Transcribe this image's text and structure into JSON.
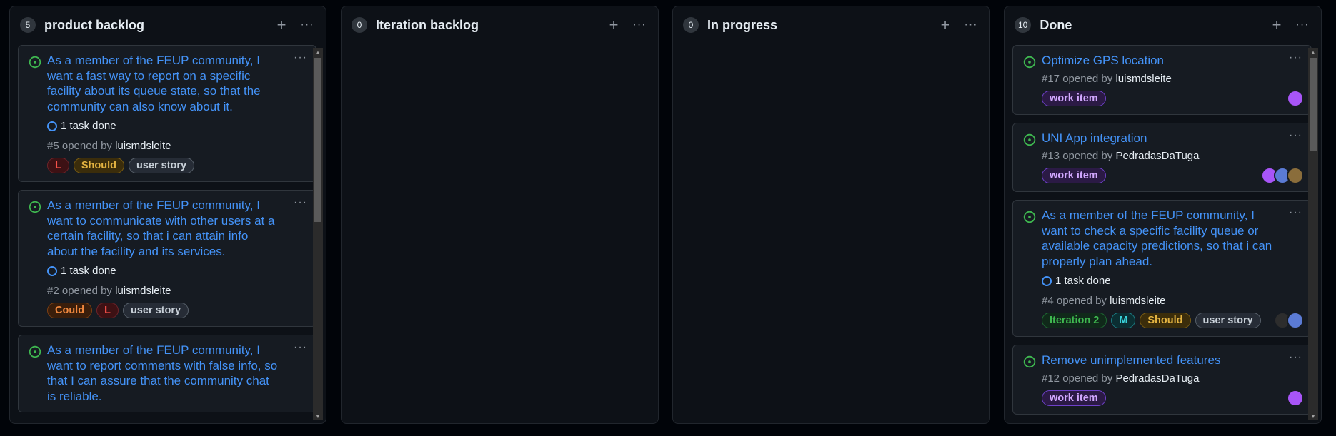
{
  "colors": {
    "page_bg": "#010409",
    "column_bg": "#0d1117",
    "card_bg": "#161b22",
    "link": "#4493f8",
    "open_green": "#3fb950",
    "muted": "#9198a1"
  },
  "icons": {
    "add": "+",
    "more": "···",
    "open_issue": "open-issue-icon",
    "task": "task-ring-icon",
    "scroll_up": "▲",
    "scroll_down": "▼"
  },
  "columns": [
    {
      "name": "product backlog",
      "count": "5",
      "scroll_position": 0.0,
      "cards": [
        {
          "title": "As a member of the FEUP community, I want a fast way to report on a specific facility about its queue state, so that the community can also know about it.",
          "tasks": "1 task done",
          "number": "#5",
          "opened_by": "opened by",
          "author": "luismdsleite",
          "labels": [
            {
              "text": "L",
              "color": "#f85149",
              "bg": "#3d1114",
              "border": "#6e2329"
            },
            {
              "text": "Should",
              "color": "#e3b341",
              "bg": "#3b2d0b",
              "border": "#7a5c12"
            },
            {
              "text": "user story",
              "color": "#c9d1d9",
              "bg": "#262c36",
              "border": "#57606a"
            }
          ]
        },
        {
          "title": "As a member of the FEUP community, I want to communicate with other users at a certain facility, so that i can attain info about the facility and its services.",
          "tasks": "1 task done",
          "number": "#2",
          "opened_by": "opened by",
          "author": "luismdsleite",
          "labels": [
            {
              "text": "Could",
              "color": "#f0883e",
              "bg": "#3a1e0b",
              "border": "#7d3f12"
            },
            {
              "text": "L",
              "color": "#f85149",
              "bg": "#3d1114",
              "border": "#6e2329"
            },
            {
              "text": "user story",
              "color": "#c9d1d9",
              "bg": "#262c36",
              "border": "#57606a"
            }
          ]
        },
        {
          "title": "As a member of the FEUP community, I want to report comments with false info, so that I can assure that the community chat is reliable."
        }
      ]
    },
    {
      "name": "Iteration backlog",
      "count": "0",
      "cards": []
    },
    {
      "name": "In progress",
      "count": "0",
      "cards": []
    },
    {
      "name": "Done",
      "count": "10",
      "scroll_position": 0.0,
      "cards": [
        {
          "title": "Optimize GPS location",
          "number": "#17",
          "opened_by": "opened by",
          "author": "luismdsleite",
          "labels": [
            {
              "text": "work item",
              "color": "#d2a8ff",
              "bg": "#2b1a45",
              "border": "#6e40c9"
            }
          ],
          "avatars": [
            "#a855f7"
          ]
        },
        {
          "title": "UNI App integration",
          "number": "#13",
          "opened_by": "opened by",
          "author": "PedradasDaTuga",
          "labels": [
            {
              "text": "work item",
              "color": "#d2a8ff",
              "bg": "#2b1a45",
              "border": "#6e40c9"
            }
          ],
          "avatars": [
            "#a855f7",
            "#5b7bd5",
            "#8a6d3b"
          ]
        },
        {
          "title": "As a member of the FEUP community, I want to check a specific facility queue or available capacity predictions, so that i can properly plan ahead.",
          "tasks": "1 task done",
          "number": "#4",
          "opened_by": "opened by",
          "author": "luismdsleite",
          "labels": [
            {
              "text": "Iteration 2",
              "color": "#3fb950",
              "bg": "#10291a",
              "border": "#1f6b33"
            },
            {
              "text": "M",
              "color": "#39d0d8",
              "bg": "#0b2e32",
              "border": "#1b7c83"
            },
            {
              "text": "Should",
              "color": "#e3b341",
              "bg": "#3b2d0b",
              "border": "#7a5c12"
            },
            {
              "text": "user story",
              "color": "#c9d1d9",
              "bg": "#262c36",
              "border": "#57606a"
            }
          ],
          "avatars": [
            "#2d2d2d",
            "#5b7bd5"
          ]
        },
        {
          "title": "Remove unimplemented features",
          "number": "#12",
          "opened_by": "opened by",
          "author": "PedradasDaTuga",
          "labels": [
            {
              "text": "work item",
              "color": "#d2a8ff",
              "bg": "#2b1a45",
              "border": "#6e40c9"
            }
          ],
          "avatars": [
            "#a855f7"
          ]
        }
      ]
    }
  ]
}
